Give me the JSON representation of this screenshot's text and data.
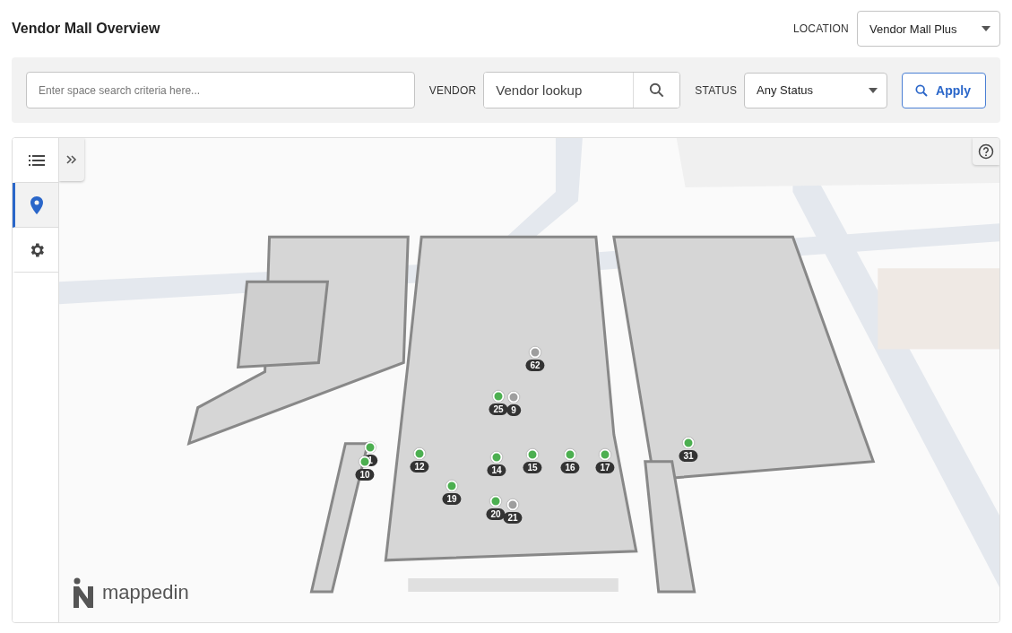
{
  "title": "Vendor Mall Overview",
  "location": {
    "label": "LOCATION",
    "value": "Vendor Mall Plus"
  },
  "filters": {
    "search": {
      "placeholder": "Enter space search criteria here..."
    },
    "vendor": {
      "label": "VENDOR",
      "placeholder": "Vendor lookup"
    },
    "status": {
      "label": "STATUS",
      "value": "Any Status"
    },
    "apply": "Apply"
  },
  "side_tabs": [
    {
      "kind": "list",
      "selected": false
    },
    {
      "kind": "pin",
      "selected": true
    },
    {
      "kind": "settings",
      "selected": false
    }
  ],
  "map": {
    "logo": "mappedin",
    "pins": [
      {
        "label": "62",
        "color": "#9e9e9e"
      },
      {
        "label": "25",
        "color": "#4caf50"
      },
      {
        "label": "9",
        "color": "#9e9e9e"
      },
      {
        "label": "1",
        "color": "#4caf50"
      },
      {
        "label": "10",
        "color": "#4caf50"
      },
      {
        "label": "12",
        "color": "#4caf50"
      },
      {
        "label": "14",
        "color": "#4caf50"
      },
      {
        "label": "15",
        "color": "#4caf50"
      },
      {
        "label": "16",
        "color": "#4caf50"
      },
      {
        "label": "17",
        "color": "#4caf50"
      },
      {
        "label": "19",
        "color": "#4caf50"
      },
      {
        "label": "20",
        "color": "#4caf50"
      },
      {
        "label": "21",
        "color": "#9e9e9e"
      },
      {
        "label": "31",
        "color": "#4caf50"
      }
    ]
  }
}
